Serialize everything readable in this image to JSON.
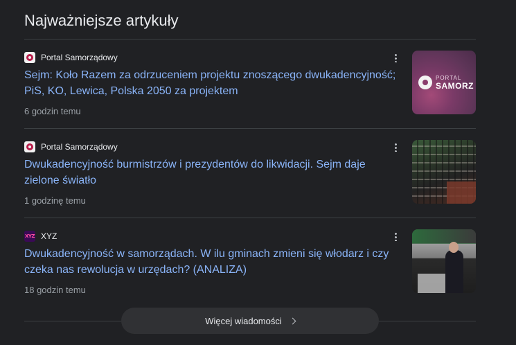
{
  "section_title": "Najważniejsze artykuły",
  "articles": [
    {
      "source": "Portal Samorządowy",
      "source_icon": "portal-samorzadowy-favicon",
      "headline": "Sejm: Koło Razem za odrzuceniem projektu znoszącego dwukadencyjność; PiS, KO, Lewica, Polska 2050 za projektem",
      "time": "6 godzin temu",
      "thumbnail_text_small": "PORTAL",
      "thumbnail_text_big": "SAMORZ"
    },
    {
      "source": "Portal Samorządowy",
      "source_icon": "portal-samorzadowy-favicon",
      "headline": "Dwukadencyjność burmistrzów i prezydentów do likwidacji. Sejm daje zielone światło",
      "time": "1 godzinę temu"
    },
    {
      "source": "XYZ",
      "source_icon": "xyz-favicon",
      "favicon_text": "XYZ",
      "headline": "Dwukadencyjność w samorządach. W ilu gminach zmieni się włodarz i czy czeka nas rewolucja w urzędach? (ANALIZA)",
      "time": "18 godzin temu"
    }
  ],
  "more_news_label": "Więcej wiadomości",
  "colors": {
    "background": "#202124",
    "headline_link": "#8ab4f8",
    "meta_text": "#9aa0a6",
    "divider": "#3c4043",
    "button_bg": "#303134"
  }
}
